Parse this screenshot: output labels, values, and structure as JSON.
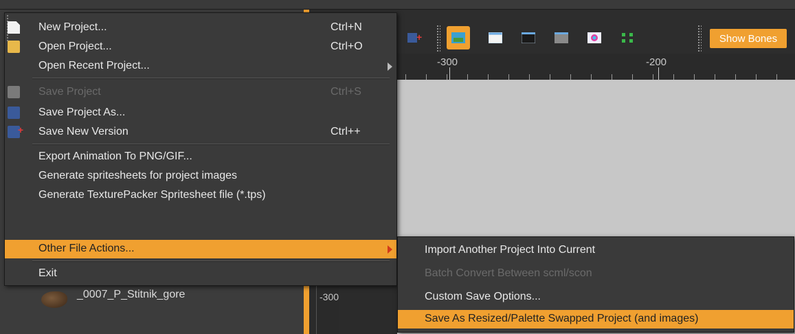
{
  "toolbar": {
    "show_bones_label": "Show Bones",
    "buttons": [
      "save-new-version-icon",
      "image-icon",
      "window-icon",
      "dark-window-icon",
      "gray-window-icon",
      "color-wheel-icon",
      "fit-icon"
    ]
  },
  "ruler": {
    "left_label": "-300",
    "right_label": "-200"
  },
  "vruler": {
    "label": "-300"
  },
  "tree": {
    "item_label": "_0007_P_Stitnik_gore"
  },
  "file_menu": {
    "items": [
      {
        "label": "New Project...",
        "shortcut": "Ctrl+N",
        "icon": "new-document-icon"
      },
      {
        "label": "Open Project...",
        "shortcut": "Ctrl+O",
        "icon": "open-folder-icon"
      },
      {
        "label": "Open Recent Project...",
        "shortcut": ""
      },
      {
        "label": "Save Project",
        "shortcut": "Ctrl+S",
        "icon": "save-icon",
        "disabled": true
      },
      {
        "label": "Save Project As...",
        "shortcut": "",
        "icon": "save-as-icon"
      },
      {
        "label": "Save New Version",
        "shortcut": "Ctrl++",
        "icon": "save-new-version-icon"
      },
      {
        "label": "Export Animation To PNG/GIF...",
        "shortcut": ""
      },
      {
        "label": "Generate spritesheets for project images",
        "shortcut": ""
      },
      {
        "label": "Generate TexturePacker Spritesheet file (*.tps)",
        "shortcut": ""
      },
      {
        "label": "Other File Actions...",
        "shortcut": "",
        "highlighted": true
      },
      {
        "label": "Exit",
        "shortcut": ""
      }
    ]
  },
  "sub_menu": {
    "items": [
      {
        "label": "Import Another Project Into Current"
      },
      {
        "label": "Batch Convert Between scml/scon",
        "disabled": true
      },
      {
        "label": "Custom Save Options..."
      },
      {
        "label": "Save As Resized/Palette Swapped Project (and images)",
        "highlighted": true
      }
    ]
  },
  "colors": {
    "accent": "#f0a030",
    "menu_bg": "#3a3a3a",
    "canvas": "#c7c7c7"
  }
}
